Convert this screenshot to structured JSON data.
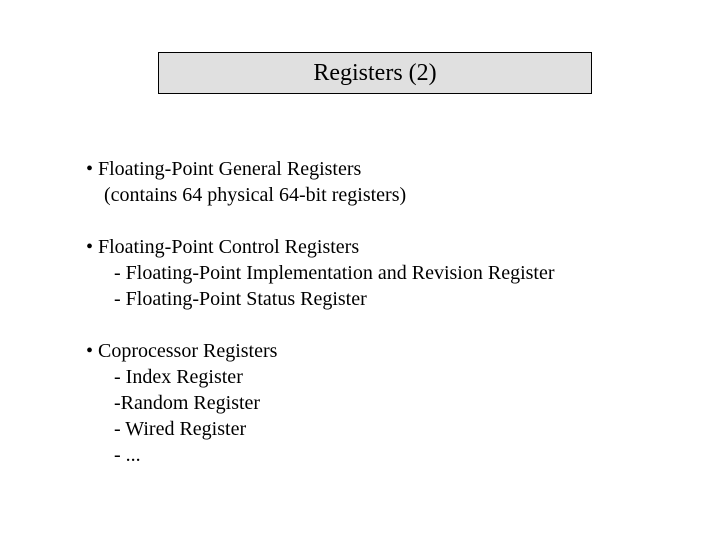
{
  "title": "Registers (2)",
  "blocks": [
    {
      "bullet": "• Floating-Point General Registers",
      "lines": [
        "(contains 64 physical 64-bit registers)"
      ]
    },
    {
      "bullet": "• Floating-Point Control Registers",
      "lines": [
        "- Floating-Point Implementation and Revision Register",
        "- Floating-Point Status Register"
      ]
    },
    {
      "bullet": "• Coprocessor Registers",
      "lines": [
        "- Index Register",
        "-Random Register",
        "- Wired Register",
        "- ..."
      ]
    }
  ]
}
